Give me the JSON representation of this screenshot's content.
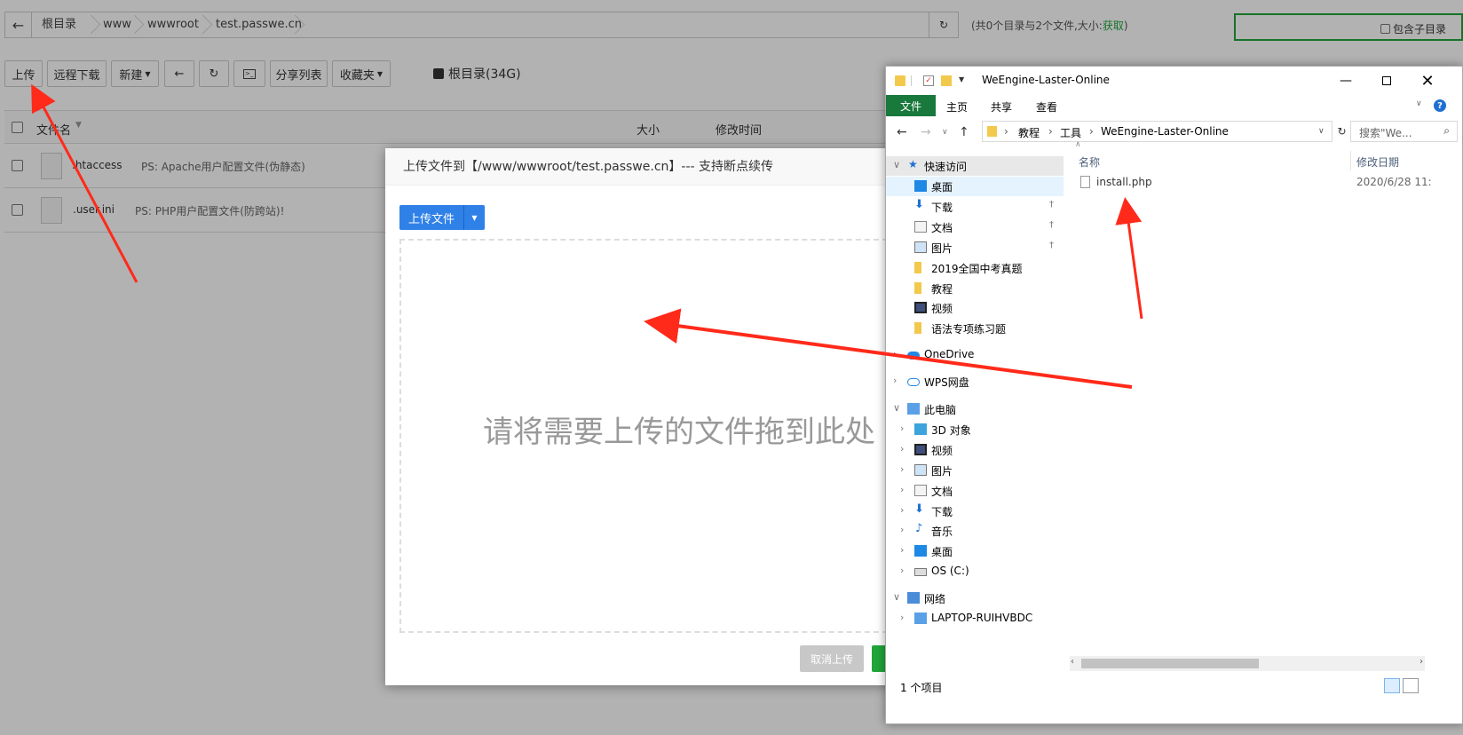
{
  "breadcrumb": [
    "根目录",
    "www",
    "wwwroot",
    "test.passwe.cn"
  ],
  "summary": {
    "text": "(共0个目录与2个文件,大小:",
    "link": "获取",
    "close": ")"
  },
  "search": {
    "checkbox_label": "包含子目录"
  },
  "toolbar": {
    "upload": "上传",
    "remote_download": "远程下载",
    "new": "新建",
    "share_list": "分享列表",
    "favorites": "收藏夹",
    "disk": "根目录(34G)"
  },
  "table": {
    "headers": {
      "name": "文件名",
      "size": "大小",
      "modified": "修改时间"
    },
    "rows": [
      {
        "name": ".htaccess",
        "ps": "PS: Apache用户配置文件(伪静态)"
      },
      {
        "name": ".user.ini",
        "ps": "PS: PHP用户配置文件(防跨站)!"
      }
    ]
  },
  "upload_dialog": {
    "title": "上传文件到【/www/wwwroot/test.passwe.cn】--- 支持断点续传",
    "upload_button": "上传文件",
    "drop_hint": "请将需要上传的文件拖到此处",
    "cancel_button": "取消上传"
  },
  "explorer": {
    "title": "WeEngine-Laster-Online",
    "ribbon_tabs": [
      "文件",
      "主页",
      "共享",
      "查看"
    ],
    "address": [
      "教程",
      "工具",
      "WeEngine-Laster-Online"
    ],
    "search_placeholder": "搜索\"We...",
    "nav": {
      "quick_access": "快速访问",
      "quick_items": [
        "桌面",
        "下载",
        "文档",
        "图片",
        "2019全国中考真题",
        "教程",
        "视频",
        "语法专项练习题"
      ],
      "onedrive": "OneDrive",
      "wps": "WPS网盘",
      "this_pc": "此电脑",
      "pc_items": [
        "3D 对象",
        "视频",
        "图片",
        "文档",
        "下载",
        "音乐",
        "桌面",
        "OS (C:)"
      ],
      "network": "网络",
      "network_items": [
        "LAPTOP-RUIHVBDC"
      ]
    },
    "columns": {
      "name": "名称",
      "modified": "修改日期"
    },
    "files": [
      {
        "name": "install.php",
        "modified": "2020/6/28 11:"
      }
    ],
    "status": "1 个项目"
  }
}
